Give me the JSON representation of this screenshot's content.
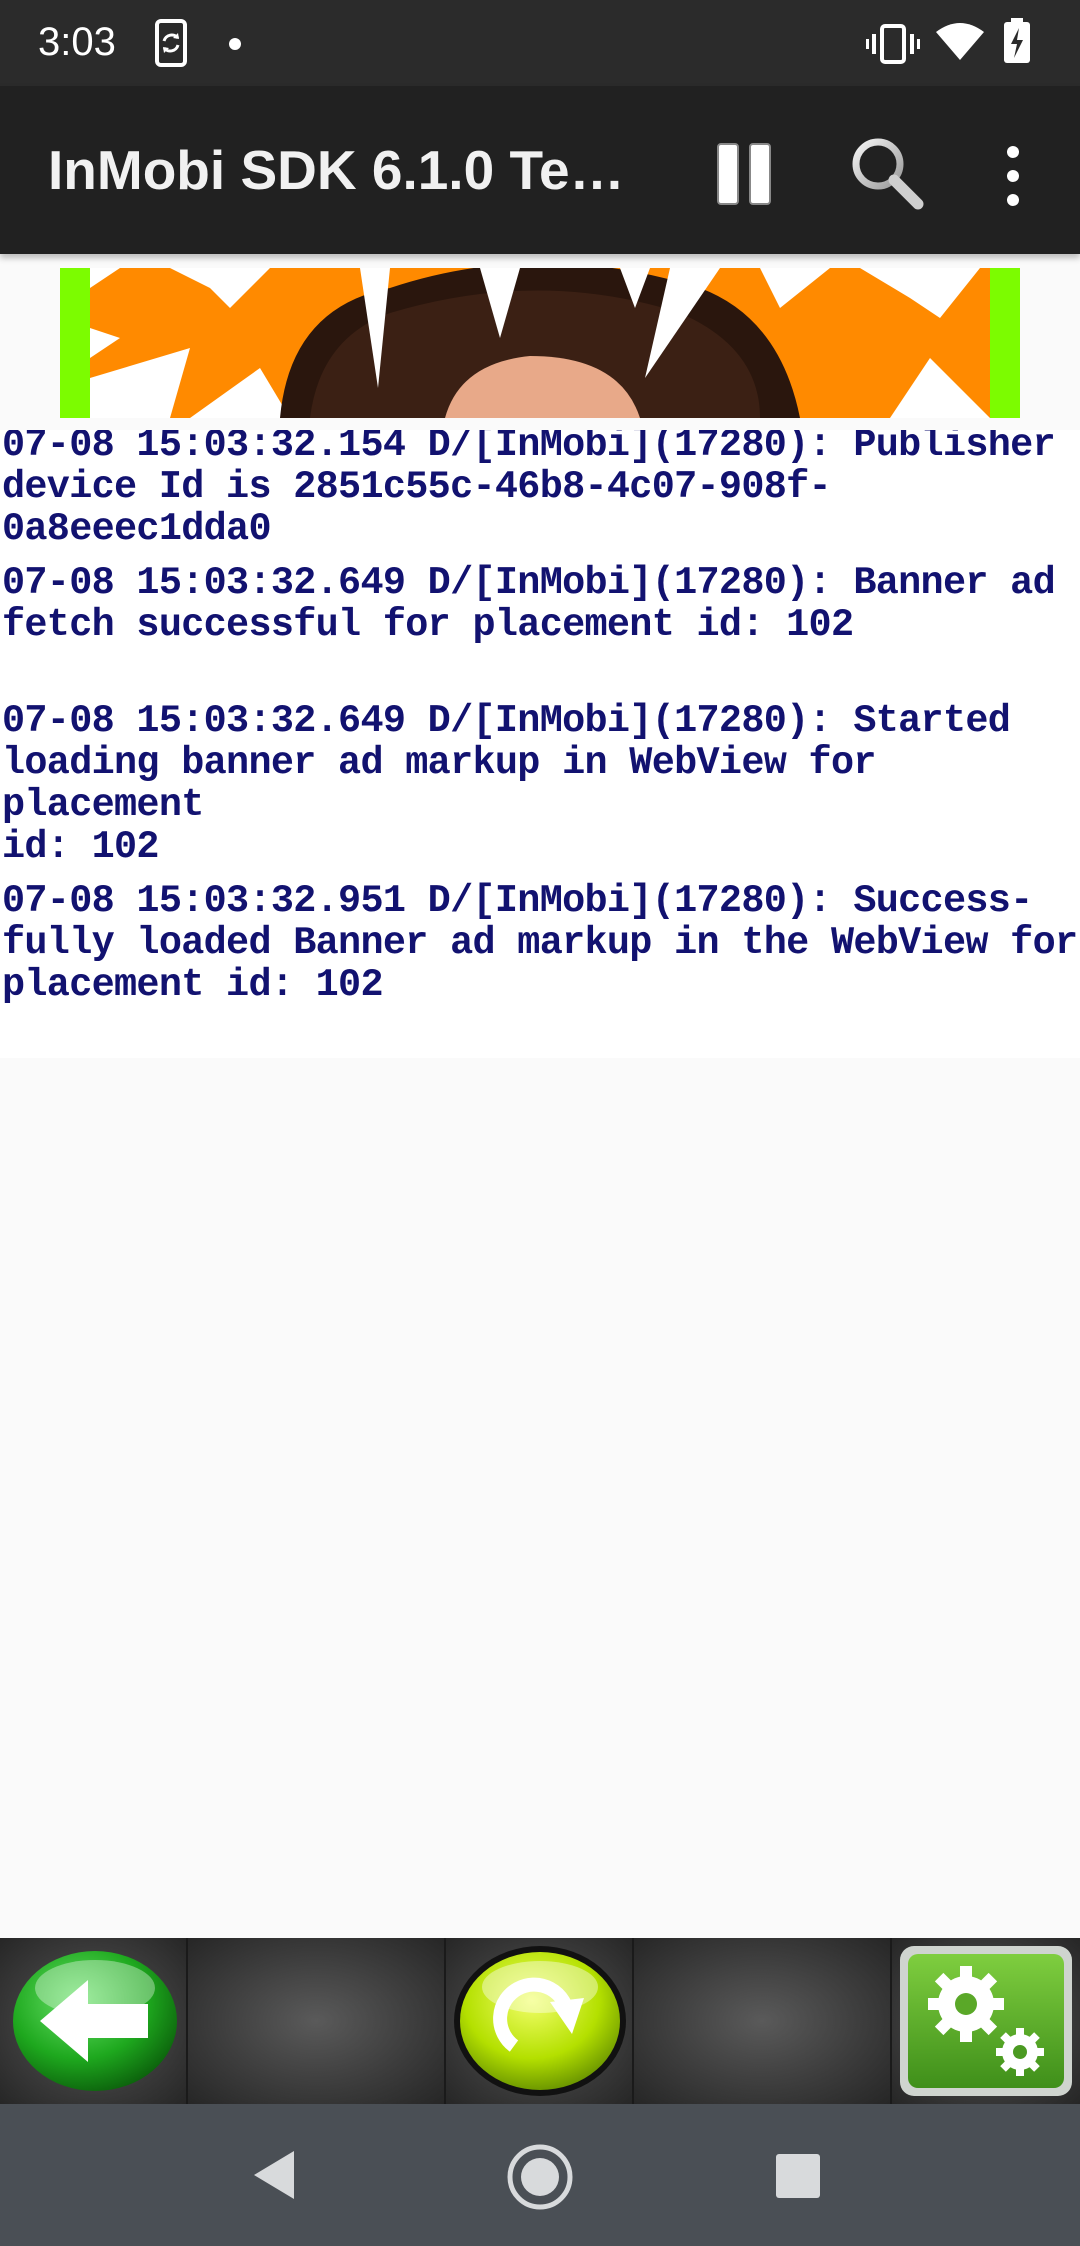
{
  "status_bar": {
    "time": "3:03",
    "icons": [
      "phone-sync-icon",
      "notification-dot-icon",
      "vibrate-icon",
      "wifi-icon",
      "battery-icon"
    ]
  },
  "app_bar": {
    "title": "InMobi SDK 6.1.0 Te…",
    "actions": [
      "pause-icon",
      "search-icon",
      "more-vert-icon"
    ]
  },
  "log": {
    "entries": [
      "07-08 15:03:32.154 D/[InMobi](17280): Publisher\ndevice Id is 2851c55c-46b8-4c07-908f-0a8eeec1dda0",
      "07-08 15:03:32.649 D/[InMobi](17280): Banner ad\nfetch successful for placement id: 102",
      "07-08 15:03:32.649 D/[InMobi](17280): Started\nloading banner ad markup in WebView for placement\nid: 102",
      "07-08 15:03:32.951 D/[InMobi](17280): Success-\nfully loaded Banner ad markup in the WebView for\nplacement id: 102"
    ]
  },
  "toolbar": {
    "buttons": [
      "back-arrow-icon",
      "refresh-icon",
      "settings-gears-icon"
    ]
  },
  "colors": {
    "log_text": "#121270",
    "app_bar": "#212121",
    "ad_orange": "#ff8a00",
    "ad_green": "#7cfc00"
  }
}
